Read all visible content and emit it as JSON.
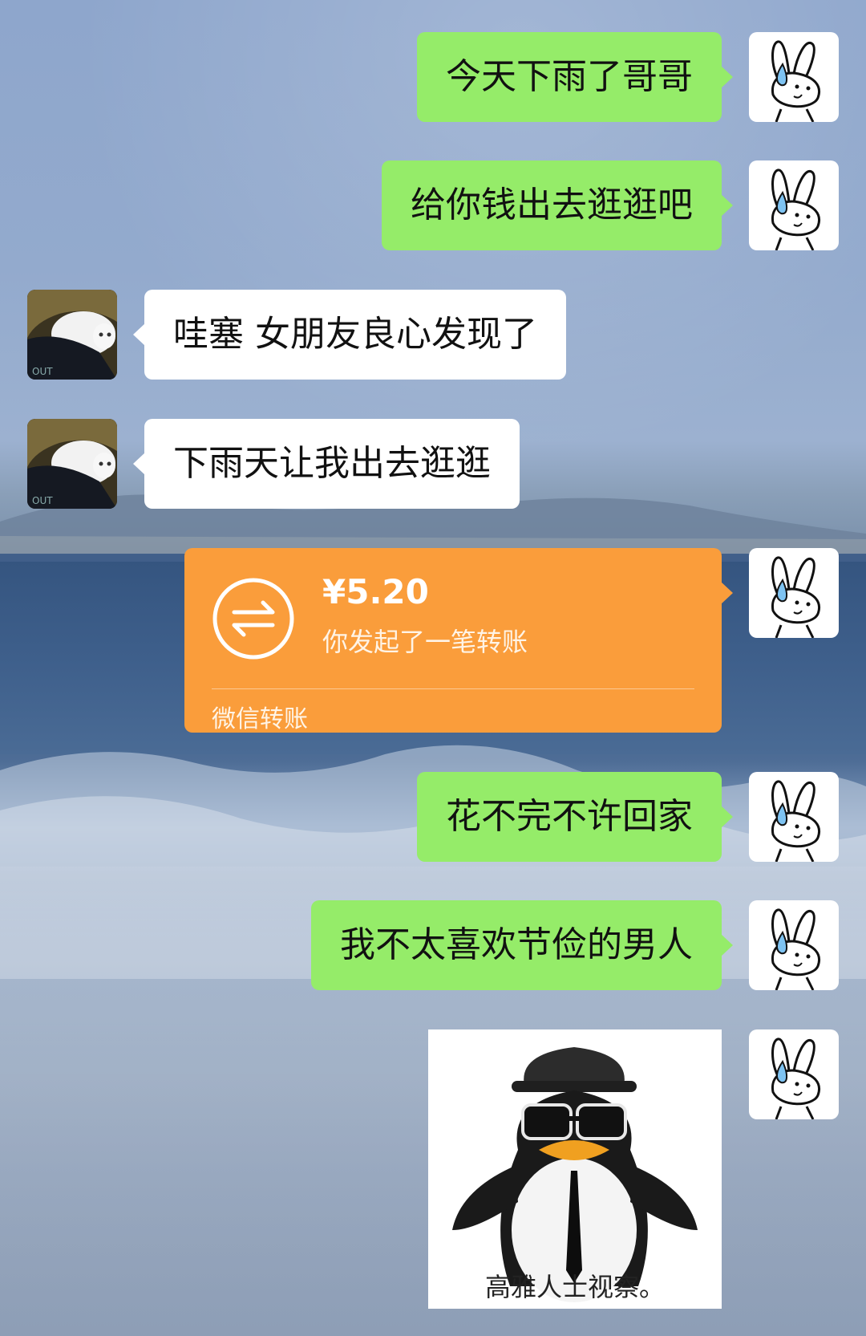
{
  "chat": {
    "messages": [
      {
        "sender": "self",
        "type": "text",
        "text": "今天下雨了哥哥"
      },
      {
        "sender": "self",
        "type": "text",
        "text": "给你钱出去逛逛吧"
      },
      {
        "sender": "other",
        "type": "text",
        "text": "哇塞 女朋友良心发现了"
      },
      {
        "sender": "other",
        "type": "text",
        "text": "下雨天让我出去逛逛"
      },
      {
        "sender": "self",
        "type": "transfer",
        "amount": "¥5.20",
        "description": "你发起了一笔转账",
        "label": "微信转账"
      },
      {
        "sender": "self",
        "type": "text",
        "text": "花不完不许回家"
      },
      {
        "sender": "self",
        "type": "text",
        "text": "我不太喜欢节俭的男人"
      },
      {
        "sender": "self",
        "type": "sticker",
        "caption": "高雅人士视察。",
        "icon": "penguin-sunglasses-sticker"
      }
    ]
  },
  "avatars": {
    "self_icon": "crying-bunny-avatar",
    "other_icon": "white-cat-avatar"
  },
  "colors": {
    "self_bubble": "#95ec69",
    "other_bubble": "#ffffff",
    "transfer": "#fa9d3b"
  }
}
